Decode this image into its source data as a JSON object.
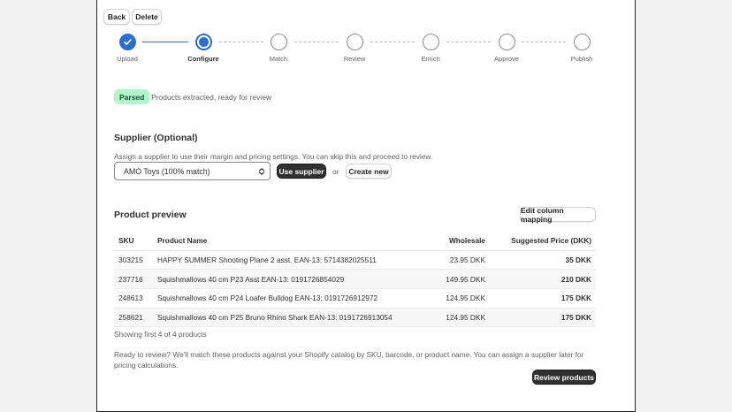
{
  "toolbar": {
    "back_label": "Back",
    "delete_label": "Delete"
  },
  "steps": [
    {
      "label": "Upload",
      "state": "done"
    },
    {
      "label": "Configure",
      "state": "current"
    },
    {
      "label": "Match",
      "state": "todo"
    },
    {
      "label": "Review",
      "state": "todo"
    },
    {
      "label": "Enrich",
      "state": "todo"
    },
    {
      "label": "Approve",
      "state": "todo"
    },
    {
      "label": "Publish",
      "state": "todo"
    }
  ],
  "status": {
    "badge": "Parsed",
    "text": "Products extracted, ready for review"
  },
  "supplier": {
    "heading": "Supplier (Optional)",
    "description": "Assign a supplier to use their margin and pricing settings. You can skip this and proceed to review.",
    "selected": "AMO Toys (100% match)",
    "use_label": "Use supplier",
    "or": "or",
    "create_label": "Create new"
  },
  "preview": {
    "heading": "Product preview",
    "edit_mapping_label": "Edit column mapping",
    "columns": [
      "SKU",
      "Product Name",
      "Wholesale",
      "Suggested Price (DKK)"
    ],
    "rows": [
      {
        "sku": "303215",
        "name": "HAPPY SUMMER Shooting Plane 2 asst. EAN-13: 5714382025511",
        "wholesale": "23.95 DKK",
        "price": "35 DKK"
      },
      {
        "sku": "237716",
        "name": "Squishmallows 40 cm P23 Asst EAN-13: 0191726854029",
        "wholesale": "149.95 DKK",
        "price": "210 DKK"
      },
      {
        "sku": "248613",
        "name": "Squishmallows 40 cm P24 Loafer Bulldog EAN-13: 0191726912972",
        "wholesale": "124.95 DKK",
        "price": "175 DKK"
      },
      {
        "sku": "258621",
        "name": "Squishmallows 40 cm P25 Bruno Rhino Shark EAN-13: 0191726913054",
        "wholesale": "124.95 DKK",
        "price": "175 DKK"
      }
    ],
    "showing": "Showing first 4 of 4 products"
  },
  "footer": {
    "line1": "Ready to review? We'll match these products against your Shopify catalog by SKU, barcode, or product name. You can assign a supplier later for",
    "line2": "pricing calculations.",
    "review_label": "Review products"
  },
  "colors": {
    "accent": "#2c6ecb",
    "badge_bg": "#b4f5c9",
    "dark_button": "#303030"
  },
  "icons": {
    "done_step": "check-icon",
    "select": "chevron-updown-icon"
  }
}
